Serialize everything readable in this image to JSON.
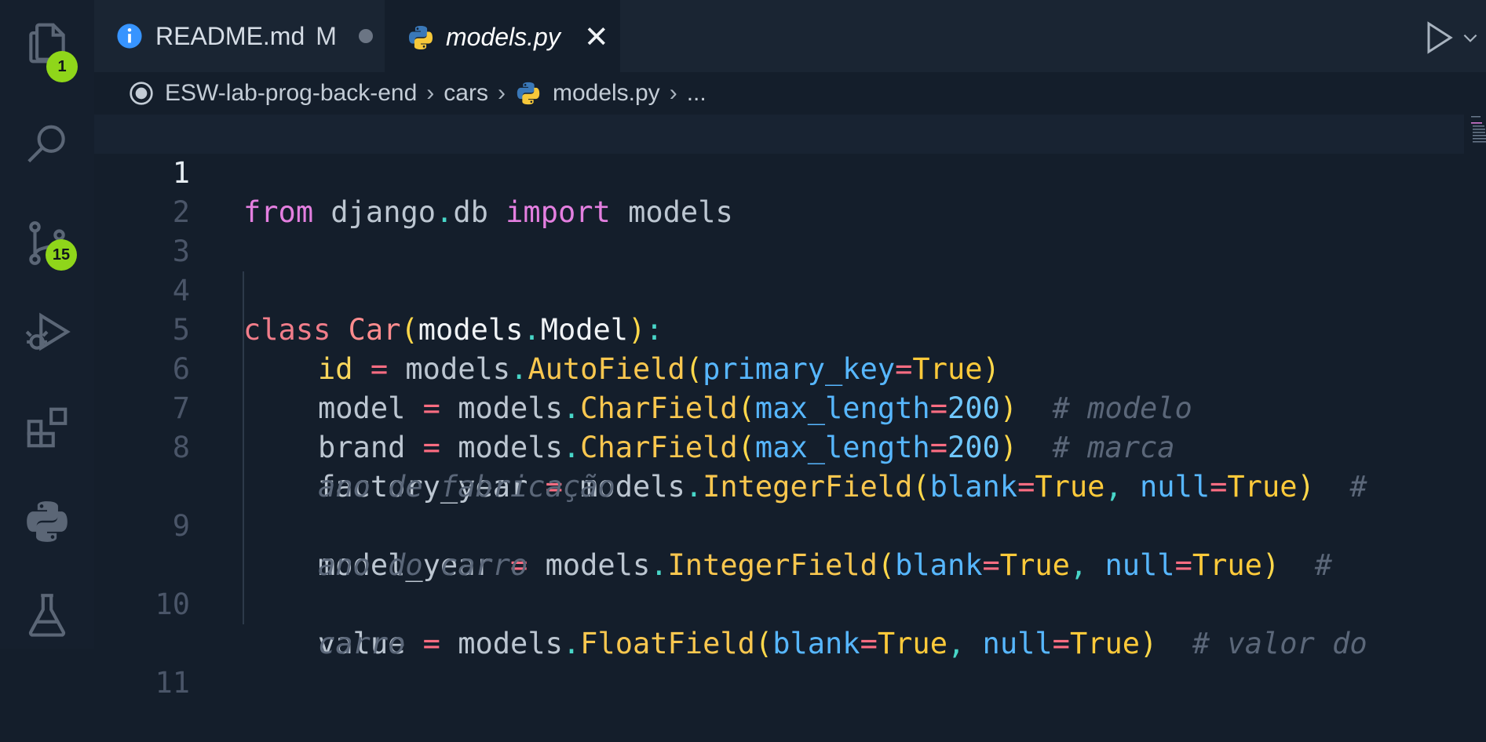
{
  "activity_bar": {
    "explorer_badge": "1",
    "scm_badge": "15",
    "badge_color": "#8fd61a"
  },
  "tabs": [
    {
      "label": "README.md",
      "modified": "M",
      "icon": "info-icon"
    },
    {
      "label": "models.py",
      "icon": "python-icon",
      "active": true
    }
  ],
  "breadcrumb": {
    "root": "ESW-lab-prog-back-end",
    "folder": "cars",
    "file": "models.py",
    "more": "..."
  },
  "editor": {
    "line_numbers": [
      "1",
      "2",
      "3",
      "4",
      "5",
      "6",
      "7",
      "8",
      "9",
      "10",
      "11"
    ],
    "lines": {
      "l1": {
        "kw_from": "from",
        "module": " django",
        "dot": ".",
        "db": "db ",
        "kw_import": "import",
        "name": " models"
      },
      "l4": {
        "kw_class": "class ",
        "cls": "Car",
        "p1": "(",
        "base1": "models",
        "dot": ".",
        "base2": "Model",
        "p2": ")",
        "colon": ":"
      },
      "l5": {
        "var": "id",
        "eq": " = ",
        "obj": "models",
        "dot": ".",
        "fn": "AutoField",
        "p1": "(",
        "param": "primary_key",
        "assign": "=",
        "val": "True",
        "p2": ")"
      },
      "l6": {
        "var": "model",
        "eq": " = ",
        "obj": "models",
        "dot": ".",
        "fn": "CharField",
        "p1": "(",
        "param": "max_length",
        "assign": "=",
        "val": "200",
        "p2": ")",
        "comment": "  # modelo"
      },
      "l7": {
        "var": "brand",
        "eq": " = ",
        "obj": "models",
        "dot": ".",
        "fn": "CharField",
        "p1": "(",
        "param": "max_length",
        "assign": "=",
        "val": "200",
        "p2": ")",
        "comment": "  # marca"
      },
      "l8": {
        "var": "factory_year",
        "eq": " = ",
        "obj": "models",
        "dot": ".",
        "fn": "IntegerField",
        "p1": "(",
        "param1": "blank",
        "assign1": "=",
        "val1": "True",
        "comma": ", ",
        "param2": "null",
        "assign2": "=",
        "val2": "True",
        "p2": ")",
        "comment": "  #",
        "comment_wrap": "ano de fabricação"
      },
      "l9": {
        "var": "model_year",
        "eq": " = ",
        "obj": "models",
        "dot": ".",
        "fn": "IntegerField",
        "p1": "(",
        "param1": "blank",
        "assign1": "=",
        "val1": "True",
        "comma": ", ",
        "param2": "null",
        "assign2": "=",
        "val2": "True",
        "p2": ")",
        "comment": "  #",
        "comment_wrap": "ano do carro"
      },
      "l10": {
        "var": "value",
        "eq": " = ",
        "obj": "models",
        "dot": ".",
        "fn": "FloatField",
        "p1": "(",
        "param1": "blank",
        "assign1": "=",
        "val1": "True",
        "comma": ", ",
        "param2": "null",
        "assign2": "=",
        "val2": "True",
        "p2": ")",
        "comment": "  # valor do",
        "comment_wrap": "carro"
      }
    }
  }
}
